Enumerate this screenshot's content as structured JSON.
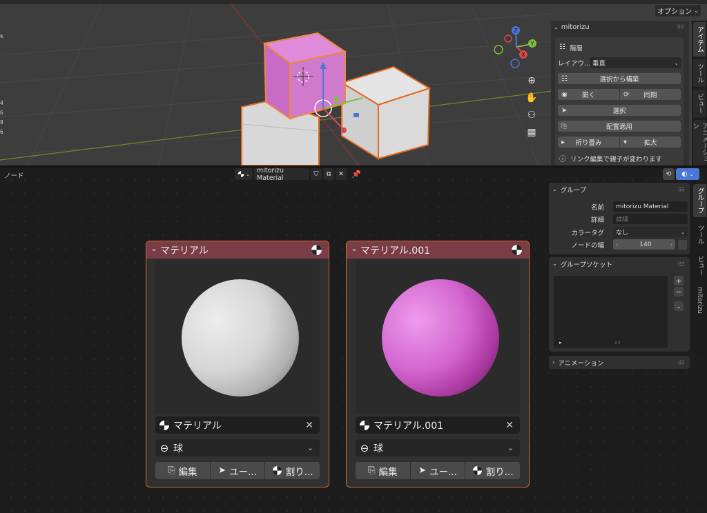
{
  "viewport": {
    "options_label": "オプション",
    "edge_digits": [
      "4",
      "6",
      "8",
      "6"
    ],
    "gizmo": {
      "z": "Z",
      "y": "Y",
      "x": "X"
    },
    "tools": [
      "zoom-icon",
      "hand-icon",
      "camera-icon",
      "grid-icon"
    ]
  },
  "n_panel": {
    "title": "mitorizu",
    "hierarchy_label": "階層",
    "layout_label": "レイアウ...",
    "layout_value": "垂直",
    "build_from_selection": "選択から構築",
    "open_label": "開く",
    "sync_label": "同期",
    "select_label": "選択",
    "apply_placement": "配置適用",
    "collapse_label": "折り畳み",
    "expand_label": "拡大",
    "info_text": "リンク編集で親子が変わります"
  },
  "viewport_tabs": [
    "アイテム",
    "ツール",
    "ビュー",
    "アニメーション"
  ],
  "node_editor": {
    "title": "ノード",
    "material_name": "mitorizu Material"
  },
  "nodes": [
    {
      "title": "マテリアル",
      "material_field": "マテリアル",
      "shape": "球",
      "btn_edit": "編集",
      "btn_user": "ユー...",
      "btn_assign": "割り...",
      "color": "#d8d8d8"
    },
    {
      "title": "マテリアル.001",
      "material_field": "マテリアル.001",
      "shape": "球",
      "btn_edit": "編集",
      "btn_user": "ユー...",
      "btn_assign": "割り...",
      "color": "#d266cf"
    }
  ],
  "side_panel": {
    "group_title": "グループ",
    "name_label": "名前",
    "name_value": "mitorizu Material",
    "detail_label": "詳細",
    "detail_placeholder": "詳細",
    "color_tag_label": "カラータグ",
    "color_tag_value": "なし",
    "node_width_label": "ノードの幅",
    "node_width_value": "140",
    "sockets_title": "グループソケット",
    "animation_title": "アニメーション"
  },
  "node_tabs": [
    "グループ",
    "ツール",
    "ビュー",
    "mitorizu"
  ],
  "colors": {
    "accent_orange": "#d0672d",
    "node_header": "#7a3d47",
    "selection_pink": "#d97fd6"
  }
}
